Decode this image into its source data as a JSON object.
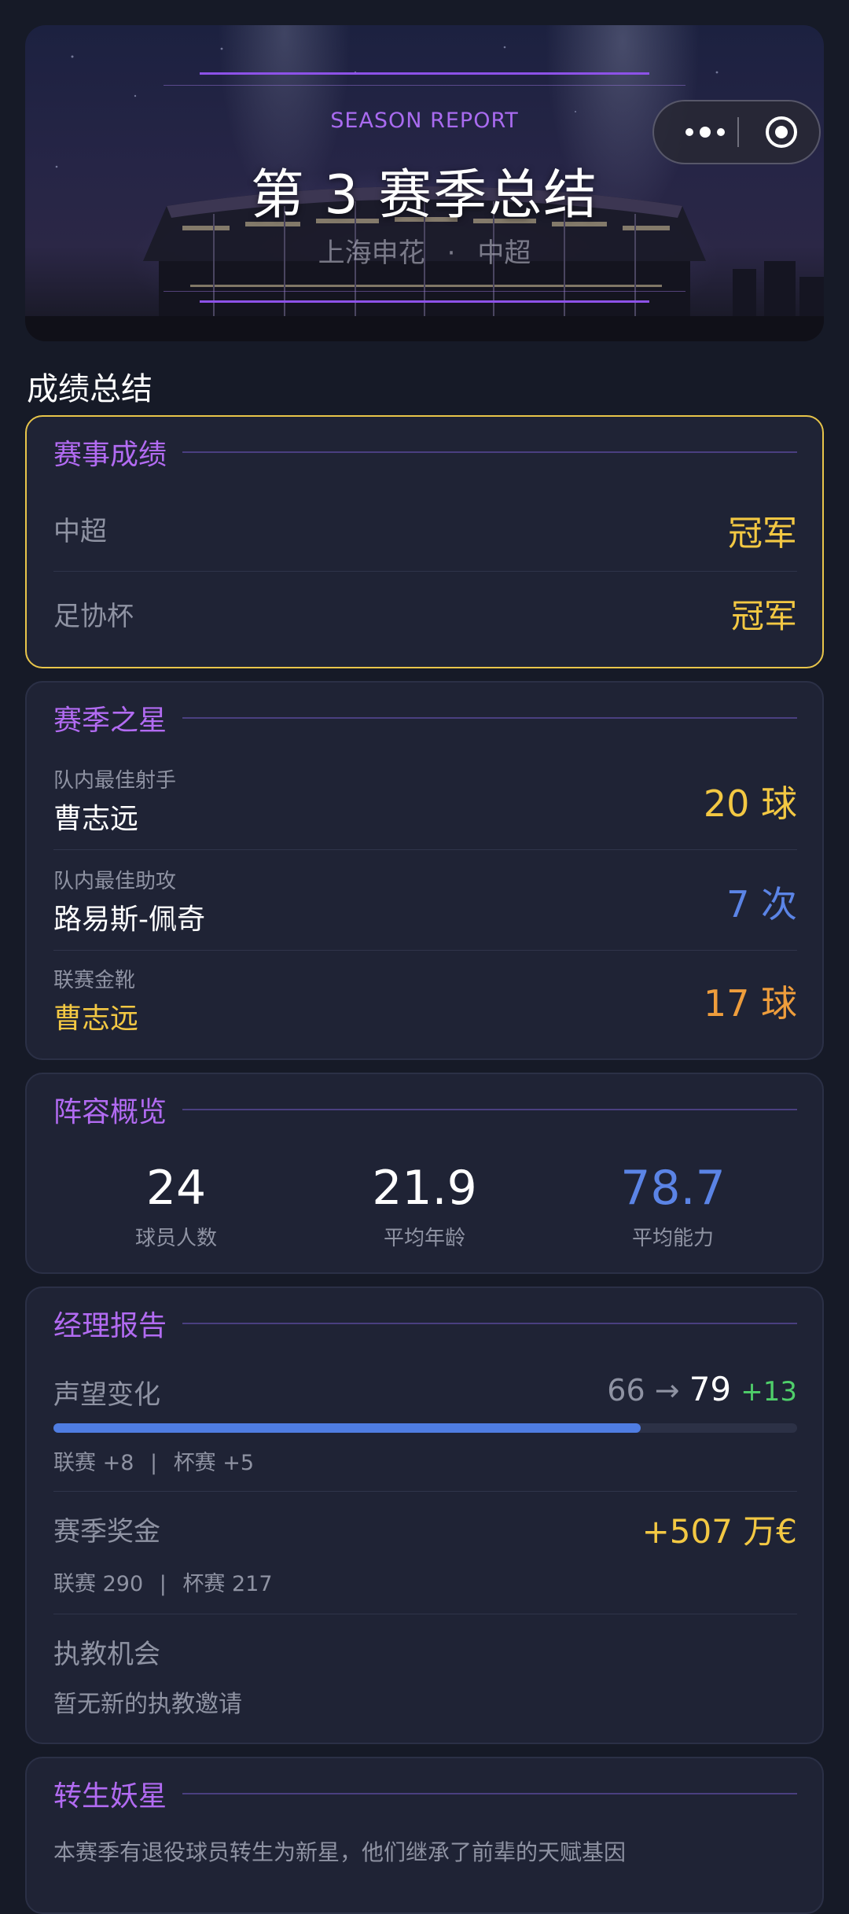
{
  "banner": {
    "tag": "SEASON REPORT",
    "title": "第 3 赛季总结",
    "club": "上海申花",
    "separator": "·",
    "league": "中超"
  },
  "capsule": {
    "more_icon": "more-dots-icon",
    "target_icon": "target-icon"
  },
  "summary_title": "成绩总结",
  "competitions": {
    "title": "赛事成绩",
    "rows": [
      {
        "name": "中超",
        "result": "冠军"
      },
      {
        "name": "足协杯",
        "result": "冠军"
      }
    ]
  },
  "stars": {
    "title": "赛季之星",
    "rows": [
      {
        "award": "队内最佳射手",
        "player": "曹志远",
        "value": "20 球",
        "color": "#f3c843"
      },
      {
        "award": "队内最佳助攻",
        "player": "路易斯-佩奇",
        "value": "7 次",
        "color": "#5b84e6"
      },
      {
        "award": "联赛金靴",
        "player": "曹志远",
        "value": "17 球",
        "color": "#ee9d3c"
      }
    ]
  },
  "squad": {
    "title": "阵容概览",
    "stats": [
      {
        "value": "24",
        "label": "球员人数"
      },
      {
        "value": "21.9",
        "label": "平均年龄"
      },
      {
        "value": "78.7",
        "label": "平均能力"
      }
    ]
  },
  "manager": {
    "title": "经理报告",
    "reputation": {
      "label": "声望变化",
      "from": "66",
      "arrow": "→",
      "to": "79",
      "delta": "+13",
      "progress": 0.79,
      "breakdown_league": "联赛 +8",
      "breakdown_sep": "|",
      "breakdown_cup": "杯赛 +5"
    },
    "prize": {
      "label": "赛季奖金",
      "value": "+507 万€",
      "breakdown_league": "联赛 290",
      "breakdown_sep": "|",
      "breakdown_cup": "杯赛 217"
    },
    "offers": {
      "label": "执教机会",
      "text": "暂无新的执教邀请"
    }
  },
  "reborn": {
    "title": "转生妖星",
    "desc": "本赛季有退役球员转生为新星，他们继承了前辈的天赋基因"
  },
  "colors": {
    "accent_purple": "#b26bf2",
    "gold": "#f3c843",
    "blue": "#5b84e6",
    "green": "#4fcf6a",
    "orange": "#ee9d3c"
  }
}
